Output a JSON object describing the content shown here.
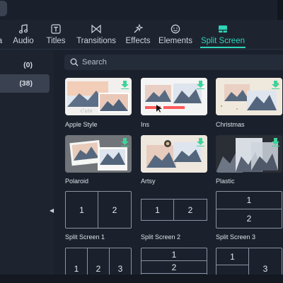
{
  "tabs": [
    {
      "label": "a",
      "icon": "media-icon"
    },
    {
      "label": "Audio",
      "icon": "music-note-icon"
    },
    {
      "label": "Titles",
      "icon": "text-t-icon"
    },
    {
      "label": "Transitions",
      "icon": "bowtie-icon"
    },
    {
      "label": "Effects",
      "icon": "sparkle-wand-icon"
    },
    {
      "label": "Elements",
      "icon": "smiley-icon"
    },
    {
      "label": "Split Screen",
      "icon": "split-screen-icon",
      "active": true
    }
  ],
  "sidebar": {
    "items": [
      {
        "label": "(0)"
      },
      {
        "label": "(38)",
        "active": true
      }
    ]
  },
  "search": {
    "placeholder": "Search"
  },
  "templates": [
    {
      "label": "Apple Style"
    },
    {
      "label": "Ins"
    },
    {
      "label": "Christmas"
    },
    {
      "label": "Polaroid"
    },
    {
      "label": "Artsy"
    },
    {
      "label": "Plastic"
    },
    {
      "label": "Split Screen 1"
    },
    {
      "label": "Split Screen 2"
    },
    {
      "label": "Split Screen 3"
    }
  ],
  "split_numbers": {
    "one": "1",
    "two": "2",
    "three": "3"
  },
  "colors": {
    "accent": "#2fd5b8",
    "download": "#3fd39a",
    "background": "#1b212c"
  }
}
